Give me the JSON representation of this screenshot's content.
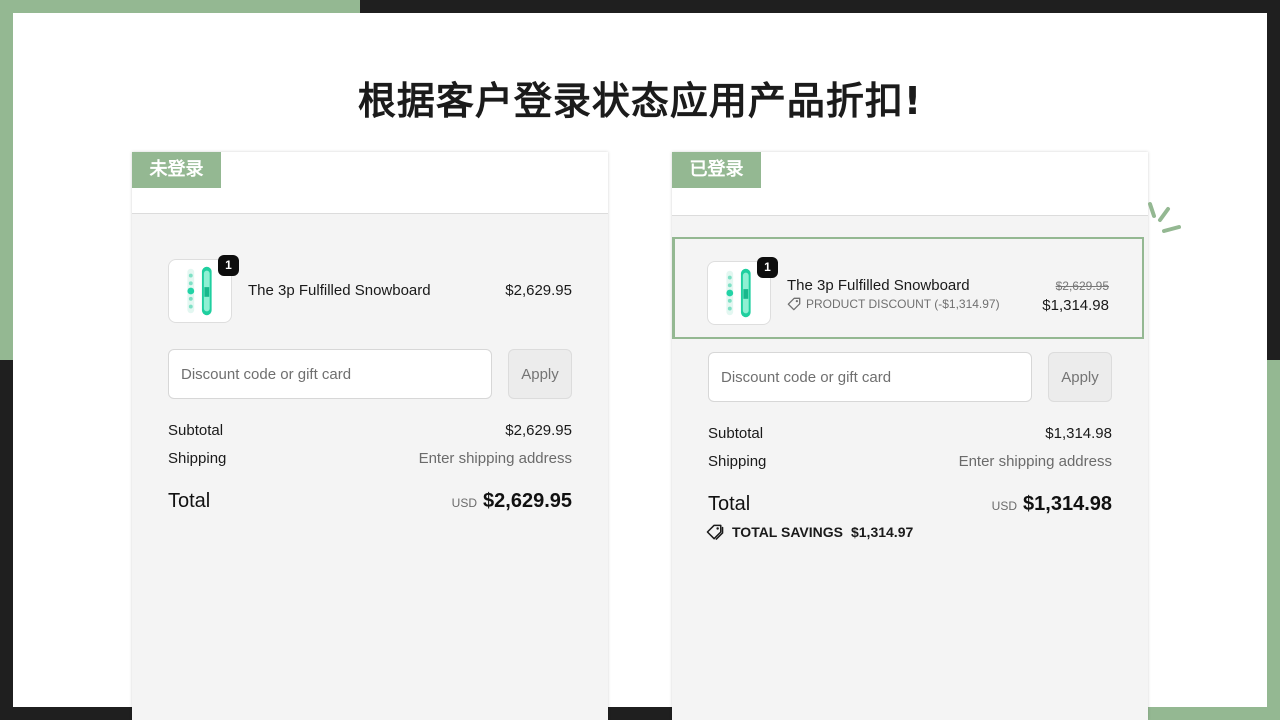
{
  "slide_title": "根据客户登录状态应用产品折扣!",
  "colors": {
    "accent_green": "#94b892",
    "dark_frame": "#1f1f1f",
    "panel_bg": "#f4f4f4"
  },
  "left_panel": {
    "status_label": "未登录",
    "item": {
      "quantity": "1",
      "name": "The 3p Fulfilled Snowboard",
      "price": "$2,629.95",
      "icon": "snowboard-thumbnail"
    },
    "discount": {
      "placeholder": "Discount code or gift card",
      "button": "Apply"
    },
    "subtotal": {
      "label": "Subtotal",
      "value": "$2,629.95"
    },
    "shipping": {
      "label": "Shipping",
      "value": "Enter shipping address"
    },
    "total": {
      "label": "Total",
      "currency": "USD",
      "amount": "$2,629.95"
    }
  },
  "right_panel": {
    "status_label": "已登录",
    "item": {
      "quantity": "1",
      "name": "The 3p Fulfilled Snowboard",
      "original_price": "$2,629.95",
      "price": "$1,314.98",
      "discount_text": "PRODUCT DISCOUNT (-$1,314.97)",
      "discount_icon": "tag-icon",
      "icon": "snowboard-thumbnail"
    },
    "discount": {
      "placeholder": "Discount code or gift card",
      "button": "Apply"
    },
    "subtotal": {
      "label": "Subtotal",
      "value": "$1,314.98"
    },
    "shipping": {
      "label": "Shipping",
      "value": "Enter shipping address"
    },
    "total": {
      "label": "Total",
      "currency": "USD",
      "amount": "$1,314.98"
    },
    "savings": {
      "label": "TOTAL SAVINGS",
      "amount": "$1,314.97",
      "icon": "tags-icon"
    }
  }
}
